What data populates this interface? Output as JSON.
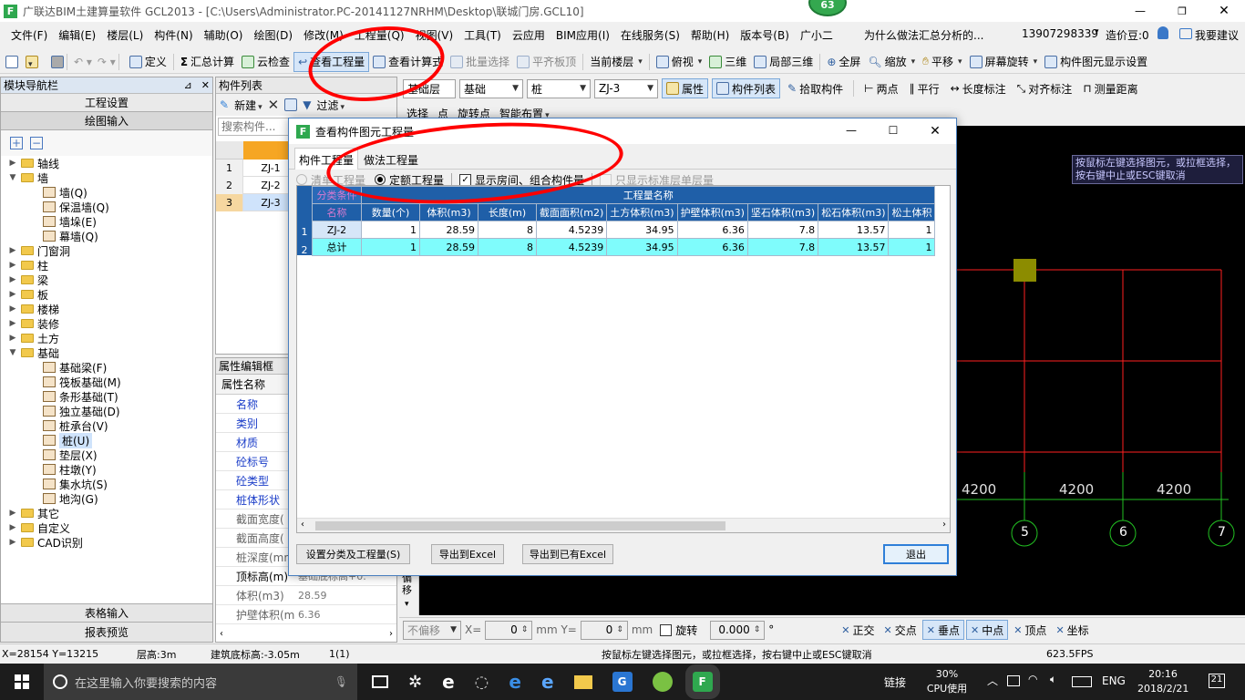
{
  "window": {
    "title": "广联达BIM土建算量软件 GCL2013 - [C:\\Users\\Administrator.PC-20141127NRHM\\Desktop\\联城门房.GCL10]",
    "badge": "63"
  },
  "menubar": {
    "items": [
      "文件(F)",
      "编辑(E)",
      "楼层(L)",
      "构件(N)",
      "辅助(O)",
      "绘图(D)",
      "修改(M)",
      "工程量(Q)",
      "视图(V)",
      "工具(T)",
      "云应用",
      "BIM应用(I)",
      "在线服务(S)",
      "帮助(H)",
      "版本号(B)",
      "广小二"
    ],
    "question": "为什么做法汇总分析的...",
    "phone": "13907298339",
    "beans": "造价豆:0",
    "feedback": "我要建议"
  },
  "toolbar1": {
    "define": "定义",
    "sum": "汇总计算",
    "cloud_check": "云检查",
    "view_qty": "查看工程量",
    "view_formula": "查看计算式",
    "batch_select": "批量选择",
    "align_top": "平齐板顶",
    "floor": "当前楼层",
    "view_top": "俯视",
    "view_3d": "三维",
    "local_3d": "局部三维",
    "fullscreen": "全屏",
    "zoom": "缩放",
    "pan": "平移",
    "rotate": "屏幕旋转",
    "show_settings": "构件图元显示设置"
  },
  "toolbar2": {
    "layer": "基础层",
    "category": "基础",
    "type": "桩",
    "member": "ZJ-3",
    "attr": "属性",
    "member_list": "构件列表",
    "pick": "拾取构件",
    "two_points": "两点",
    "parallel": "平行",
    "dimension": "长度标注",
    "align_dim": "对齐标注",
    "measure": "测量距离"
  },
  "toolbar3": {
    "select": "选择",
    "point": "点",
    "rotate_point": "旋转点",
    "smart_layout": "智能布置"
  },
  "nav": {
    "title": "模块导航栏",
    "project_settings": "工程设置",
    "drawing_input": "绘图输入",
    "tree": [
      {
        "label": "轴线",
        "level": 0,
        "expanded": false
      },
      {
        "label": "墙",
        "level": 0,
        "expanded": true
      },
      {
        "label": "墙(Q)",
        "level": 1
      },
      {
        "label": "保温墙(Q)",
        "level": 1
      },
      {
        "label": "墙垛(E)",
        "level": 1
      },
      {
        "label": "幕墙(Q)",
        "level": 1
      },
      {
        "label": "门窗洞",
        "level": 0,
        "expanded": false
      },
      {
        "label": "柱",
        "level": 0,
        "expanded": false
      },
      {
        "label": "梁",
        "level": 0,
        "expanded": false
      },
      {
        "label": "板",
        "level": 0,
        "expanded": false
      },
      {
        "label": "楼梯",
        "level": 0,
        "expanded": false
      },
      {
        "label": "装修",
        "level": 0,
        "expanded": false
      },
      {
        "label": "土方",
        "level": 0,
        "expanded": false
      },
      {
        "label": "基础",
        "level": 0,
        "expanded": true
      },
      {
        "label": "基础梁(F)",
        "level": 1
      },
      {
        "label": "筏板基础(M)",
        "level": 1
      },
      {
        "label": "条形基础(T)",
        "level": 1
      },
      {
        "label": "独立基础(D)",
        "level": 1
      },
      {
        "label": "桩承台(V)",
        "level": 1
      },
      {
        "label": "桩(U)",
        "level": 1,
        "selected": true
      },
      {
        "label": "垫层(X)",
        "level": 1
      },
      {
        "label": "柱墩(Y)",
        "level": 1
      },
      {
        "label": "集水坑(S)",
        "level": 1
      },
      {
        "label": "地沟(G)",
        "level": 1
      },
      {
        "label": "其它",
        "level": 0,
        "expanded": false
      },
      {
        "label": "自定义",
        "level": 0,
        "expanded": false
      },
      {
        "label": "CAD识别",
        "level": 0,
        "expanded": false
      }
    ],
    "table_input": "表格输入",
    "report_preview": "报表预览"
  },
  "member_list": {
    "title": "构件列表",
    "new": "新建",
    "filter": "过滤",
    "search_placeholder": "搜索构件...",
    "rows": [
      {
        "no": "1",
        "name": "ZJ-1"
      },
      {
        "no": "2",
        "name": "ZJ-2"
      },
      {
        "no": "3",
        "name": "ZJ-3"
      }
    ]
  },
  "prop_editor": {
    "title": "属性编辑框",
    "header": "属性名称",
    "rows": [
      {
        "name": "名称",
        "value": ""
      },
      {
        "name": "类别",
        "value": ""
      },
      {
        "name": "材质",
        "value": ""
      },
      {
        "name": "砼标号",
        "value": ""
      },
      {
        "name": "砼类型",
        "value": ""
      },
      {
        "name": "桩体形状",
        "value": ""
      },
      {
        "name": "截面宽度(",
        "value": ""
      },
      {
        "name": "截面高度(",
        "value": ""
      },
      {
        "name": "桩深度(mm",
        "value": ""
      },
      {
        "name": "顶标高(m)",
        "value": "基础底标高+0."
      },
      {
        "name": "体积(m3)",
        "value": "28.59"
      },
      {
        "name": "护壁体积(m",
        "value": "6.36"
      }
    ]
  },
  "dialog": {
    "title": "查看构件图元工程量",
    "tabs": [
      "构件工程量",
      "做法工程量"
    ],
    "options": {
      "list_qty": "清单工程量",
      "quota_qty": "定额工程量",
      "show_rooms": "显示房间、组合构件量",
      "only_std": "只显示标准层单层量"
    },
    "group_header": "分类条件",
    "qty_header": "工程量名称",
    "columns": [
      "名称",
      "数量(个)",
      "体积(m3)",
      "长度(m)",
      "截面面积(m2)",
      "土方体积(m3)",
      "护壁体积(m3)",
      "坚石体积(m3)",
      "松石体积(m3)",
      "松土体积"
    ],
    "rows": [
      {
        "no": "1",
        "cells": [
          "ZJ-2",
          "1",
          "28.59",
          "8",
          "4.5239",
          "34.95",
          "6.36",
          "7.8",
          "13.57",
          "1"
        ]
      },
      {
        "no": "2",
        "cells": [
          "总计",
          "1",
          "28.59",
          "8",
          "4.5239",
          "34.95",
          "6.36",
          "7.8",
          "13.57",
          "1"
        ]
      }
    ],
    "buttons": {
      "settings": "设置分类及工程量(S)",
      "export": "导出到Excel",
      "export_existing": "导出到已有Excel",
      "exit": "退出"
    }
  },
  "canvas": {
    "hint": "按鼠标左键选择图元，或拉框选择，按右键中止或ESC键取消",
    "dims": [
      "4200",
      "4200",
      "4200"
    ],
    "axes": [
      "5",
      "6",
      "7"
    ]
  },
  "coordbar": {
    "offset": "不偏移",
    "x_label": "X=",
    "x_value": "0",
    "y_label": "mm Y=",
    "y_value": "0",
    "unit": "mm",
    "rotate": "旋转",
    "angle": "0.000",
    "deg": "°",
    "snap": [
      "正交",
      "交点",
      "垂点",
      "中点",
      "顶点",
      "坐标"
    ],
    "side_label": "偏移"
  },
  "statusbar": {
    "coords": "X=28154 Y=13215",
    "floor_height": "层高:3m",
    "base_elev": "建筑底标高:-3.05m",
    "count": "1(1)",
    "hint": "按鼠标左键选择图元，或拉框选择，按右键中止或ESC键取消",
    "fps": "623.5FPS"
  },
  "taskbar": {
    "search_placeholder": "在这里输入你要搜索的内容",
    "link": "链接",
    "cpu": "30%",
    "cpu_label": "CPU使用",
    "lang": "ENG",
    "time": "20:16",
    "date": "2018/2/21",
    "notif": "21"
  },
  "colors": {
    "accent": "#ff0000",
    "grid_select": "#00ffff",
    "dialog_header": "#1f5fa8"
  }
}
